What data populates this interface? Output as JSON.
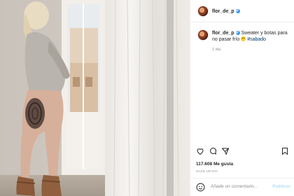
{
  "post": {
    "username": "flor_de_p",
    "caption": {
      "username": "flor_de_p",
      "text": "Sweater y botas para no pasar frío",
      "emoji_icon": "grimacing-face-emoji",
      "hashtag": "#sabado",
      "time": "1 día"
    },
    "likes_text": "117.608 Me gusta",
    "posted_ago": "HACE UN DÍA",
    "comment_placeholder": "Añade un comentario...",
    "publish_label": "Publicar"
  },
  "icons": {
    "like": "heart-icon",
    "comment": "comment-icon",
    "share": "share-icon",
    "save": "bookmark-icon",
    "emoji": "smiley-icon"
  },
  "colors": {
    "link": "#00376b",
    "verified": "#3897f0",
    "muted": "#8e8e8e",
    "publish_disabled": "#b2dffc"
  }
}
